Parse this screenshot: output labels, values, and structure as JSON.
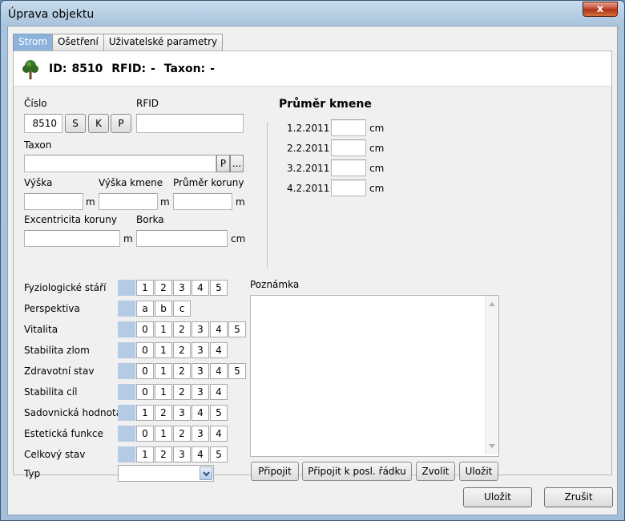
{
  "window": {
    "title": "Úprava objektu",
    "close_label": "x"
  },
  "tabs": [
    {
      "label": "Strom",
      "active": true
    },
    {
      "label": "Ošetření",
      "active": false
    },
    {
      "label": "Uživatelské parametry",
      "active": false
    }
  ],
  "header": {
    "id_label": "ID:",
    "id_value": "8510",
    "rfid_label": "RFID:",
    "rfid_value": "-",
    "taxon_label": "Taxon:",
    "taxon_value": "-"
  },
  "form": {
    "cislo_label": "Číslo",
    "cislo_value": "8510",
    "cislo_buttons": [
      "S",
      "K",
      "P"
    ],
    "rfid_label": "RFID",
    "rfid_value": "",
    "taxon_label": "Taxon",
    "taxon_value": "",
    "taxon_buttons": [
      "P",
      "..."
    ],
    "vyska_label": "Výška",
    "vyska_kmene_label": "Výška kmene",
    "prumer_koruny_label": "Průměr koruny",
    "excentricita_label": "Excentricita koruny",
    "borka_label": "Borka",
    "unit_m": "m",
    "unit_cm": "cm"
  },
  "trunk": {
    "title": "Průměr kmene",
    "unit": "cm",
    "rows": [
      {
        "date": "1.2.2011",
        "value": ""
      },
      {
        "date": "2.2.2011",
        "value": ""
      },
      {
        "date": "3.2.2011",
        "value": ""
      },
      {
        "date": "4.2.2011",
        "value": ""
      }
    ]
  },
  "ratings": [
    {
      "label": "Fyziologické stáří",
      "options": [
        "1",
        "2",
        "3",
        "4",
        "5"
      ]
    },
    {
      "label": "Perspektiva",
      "options": [
        "a",
        "b",
        "c"
      ]
    },
    {
      "label": "Vitalita",
      "options": [
        "0",
        "1",
        "2",
        "3",
        "4",
        "5"
      ]
    },
    {
      "label": "Stabilita zlom",
      "options": [
        "0",
        "1",
        "2",
        "3",
        "4"
      ]
    },
    {
      "label": "Zdravotní stav",
      "options": [
        "0",
        "1",
        "2",
        "3",
        "4",
        "5"
      ]
    },
    {
      "label": "Stabilita cíl",
      "options": [
        "0",
        "1",
        "2",
        "3",
        "4"
      ]
    },
    {
      "label": "Sadovnická hodnota",
      "options": [
        "1",
        "2",
        "3",
        "4",
        "5"
      ]
    },
    {
      "label": "Estetická funkce",
      "options": [
        "0",
        "1",
        "2",
        "3",
        "4"
      ]
    },
    {
      "label": "Celkový stav",
      "options": [
        "1",
        "2",
        "3",
        "4",
        "5"
      ]
    }
  ],
  "typ": {
    "label": "Typ",
    "value": ""
  },
  "note": {
    "label": "Poznámka",
    "value": "",
    "buttons": [
      "Připojit",
      "Připojit k posl. řádku",
      "Zvolit",
      "Uložit"
    ]
  },
  "footer": {
    "save_label": "Uložit",
    "cancel_label": "Zrušit"
  },
  "colors": {
    "tab_active": "#8db3dc",
    "rating_swatch": "#b4cbe3",
    "close": "#c2432a"
  }
}
